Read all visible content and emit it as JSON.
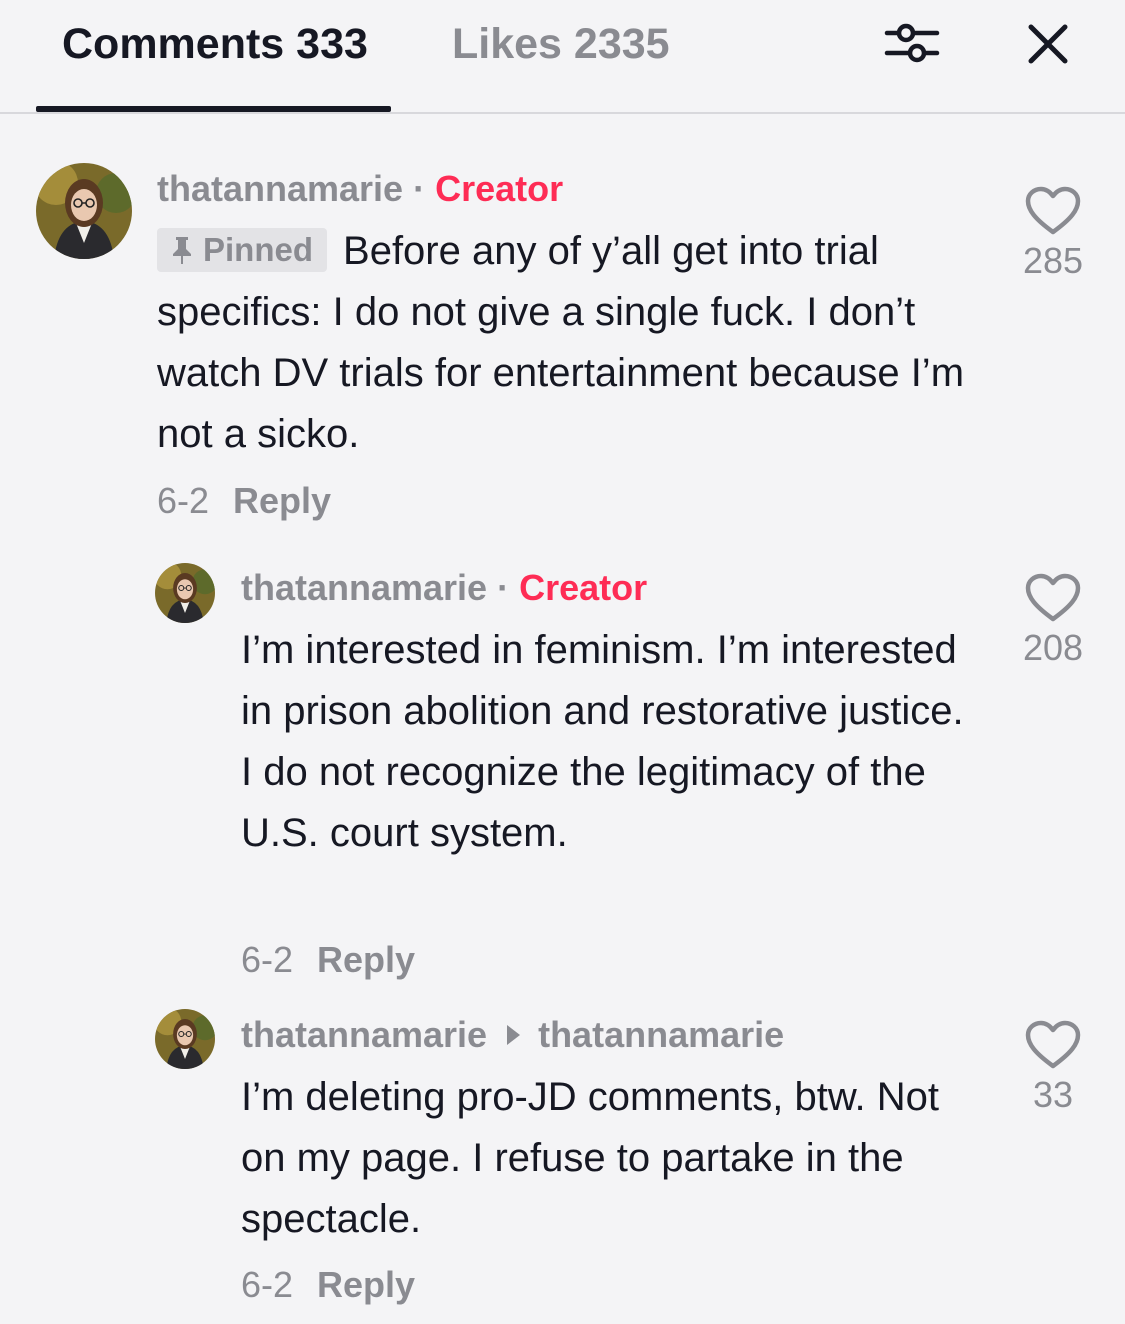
{
  "tabs": {
    "comments_label": "Comments 333",
    "likes_label": "Likes 2335"
  },
  "comments": [
    {
      "username": "thatannamarie",
      "creator_label": "Creator",
      "pinned_label": "Pinned",
      "text": "Before any of y’all get into trial specifics: I do not give a single fuck. I don’t watch DV trials for entertainment because I’m not a sicko.",
      "date": "6-2",
      "reply_label": "Reply",
      "likes": "285"
    },
    {
      "username": "thatannamarie",
      "creator_label": "Creator",
      "text": "I’m interested in feminism. I’m interested in prison abolition and restorative justice. I do not recognize the legitimacy of the U.S. court system.",
      "date": "6-2",
      "reply_label": "Reply",
      "likes": "208"
    },
    {
      "username": "thatannamarie",
      "reply_to": "thatannamarie",
      "text": "I’m deleting pro-JD comments, btw. Not on my page. I refuse to partake in the spectacle.",
      "date": "6-2",
      "reply_label": "Reply",
      "likes": "33"
    }
  ],
  "colors": {
    "accent": "#fe2c55",
    "muted": "#8a8b91",
    "text": "#161823",
    "background": "#f4f4f6"
  },
  "icons": [
    "filter-icon",
    "close-icon",
    "heart-icon",
    "pin-icon",
    "avatar"
  ]
}
